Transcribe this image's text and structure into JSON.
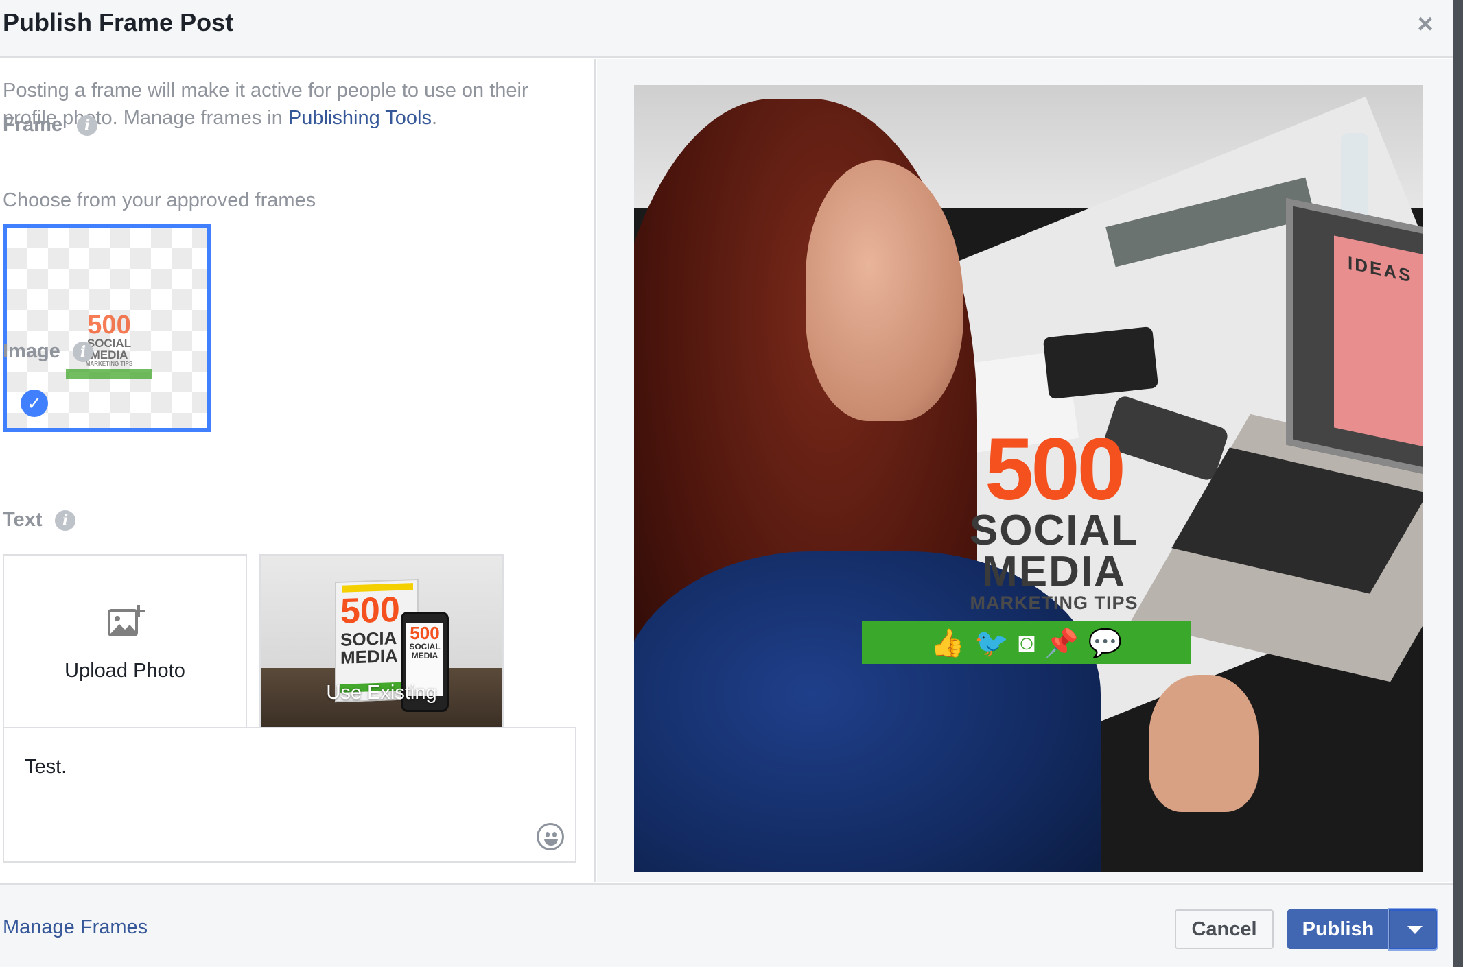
{
  "dialog": {
    "title": "Publish Frame Post",
    "close_symbol": "×"
  },
  "intro": {
    "text": "Posting a frame will make it active for people to use on their profile photo. Manage frames in ",
    "link": "Publishing Tools",
    "suffix": "."
  },
  "frame_section": {
    "label": "Frame",
    "subtext": "Choose from your approved frames",
    "selected_frame": {
      "line1": "500",
      "line2": "SOCIAL",
      "line3": "MEDIA",
      "line4": "MARKETING TIPS"
    }
  },
  "image_section": {
    "label": "Image",
    "upload_label": "Upload Photo",
    "existing_label": "Use Existing",
    "book_number": "500",
    "book_text": "SOCIA\nMEDIA",
    "phone_number": "500",
    "phone_text": "SOCIAL\nMEDIA"
  },
  "text_section": {
    "label": "Text",
    "value": "Test."
  },
  "preview": {
    "screen_text": "IDEAS",
    "logo_number": "500",
    "logo_line2": "SOCIAL",
    "logo_line3": "MEDIA",
    "logo_line4": "MARKETING TIPS",
    "icons": [
      "thumbs-up-icon",
      "twitter-bird-icon",
      "instagram-icon",
      "pin-icon",
      "speech-bubble-icon"
    ]
  },
  "footer": {
    "manage_frames": "Manage Frames",
    "cancel": "Cancel",
    "publish": "Publish"
  },
  "colors": {
    "primary_blue": "#4267b2",
    "link_blue": "#365899",
    "selection_blue": "#4080ff",
    "logo_orange": "#f4511e",
    "logo_green": "#3aa82a"
  }
}
